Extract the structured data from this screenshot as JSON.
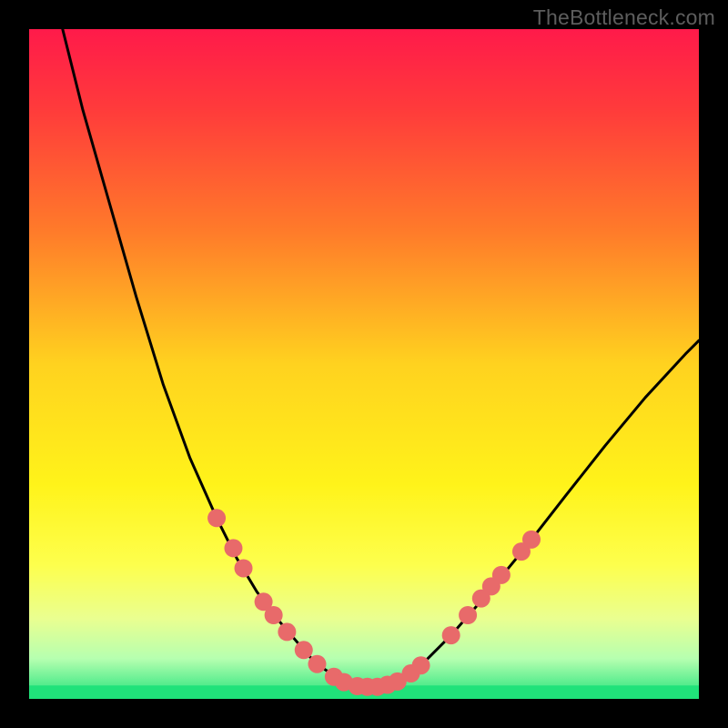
{
  "watermark": "TheBottleneck.com",
  "chart_data": {
    "type": "line",
    "title": "",
    "xlabel": "",
    "ylabel": "",
    "xlim": [
      0,
      100
    ],
    "ylim": [
      0,
      100
    ],
    "grid": false,
    "legend": false,
    "background_gradient": {
      "stops": [
        {
          "offset": 0.0,
          "color": "#ff1a4a"
        },
        {
          "offset": 0.12,
          "color": "#ff3b3b"
        },
        {
          "offset": 0.3,
          "color": "#ff7a2a"
        },
        {
          "offset": 0.5,
          "color": "#ffd21f"
        },
        {
          "offset": 0.68,
          "color": "#fff31a"
        },
        {
          "offset": 0.8,
          "color": "#fdff4d"
        },
        {
          "offset": 0.88,
          "color": "#eaff90"
        },
        {
          "offset": 0.94,
          "color": "#b6ffb0"
        },
        {
          "offset": 1.0,
          "color": "#20e27a"
        }
      ]
    },
    "series": [
      {
        "name": "curve",
        "x": [
          5,
          8,
          12,
          16,
          20,
          24,
          28,
          31,
          34,
          37,
          40,
          42,
          44,
          46,
          48,
          50,
          52,
          54,
          56,
          59,
          63,
          68,
          74,
          80,
          86,
          92,
          98,
          100
        ],
        "y": [
          100,
          88,
          74,
          60,
          47,
          36,
          27,
          21,
          16,
          12,
          8.5,
          6.2,
          4.5,
          3.2,
          2.3,
          1.8,
          1.8,
          2.3,
          3.3,
          5.5,
          9.5,
          15.2,
          22.5,
          30.2,
          37.8,
          45.0,
          51.5,
          53.5
        ]
      }
    ],
    "bottom_band": {
      "y_from": 0,
      "y_to": 2.0,
      "color": "#20e27a"
    },
    "markers": {
      "color": "#e86a6a",
      "radius": 10,
      "points": [
        {
          "x": 28.0,
          "y": 27.0
        },
        {
          "x": 30.5,
          "y": 22.5
        },
        {
          "x": 32.0,
          "y": 19.5
        },
        {
          "x": 35.0,
          "y": 14.5
        },
        {
          "x": 36.5,
          "y": 12.5
        },
        {
          "x": 38.5,
          "y": 10.0
        },
        {
          "x": 41.0,
          "y": 7.3
        },
        {
          "x": 43.0,
          "y": 5.2
        },
        {
          "x": 45.5,
          "y": 3.3
        },
        {
          "x": 47.0,
          "y": 2.5
        },
        {
          "x": 49.0,
          "y": 1.9
        },
        {
          "x": 50.5,
          "y": 1.8
        },
        {
          "x": 52.0,
          "y": 1.8
        },
        {
          "x": 53.5,
          "y": 2.1
        },
        {
          "x": 55.0,
          "y": 2.6
        },
        {
          "x": 57.0,
          "y": 3.8
        },
        {
          "x": 58.5,
          "y": 5.0
        },
        {
          "x": 63.0,
          "y": 9.5
        },
        {
          "x": 65.5,
          "y": 12.5
        },
        {
          "x": 67.5,
          "y": 15.0
        },
        {
          "x": 69.0,
          "y": 16.8
        },
        {
          "x": 70.5,
          "y": 18.5
        },
        {
          "x": 73.5,
          "y": 22.0
        },
        {
          "x": 75.0,
          "y": 23.8
        }
      ]
    }
  }
}
